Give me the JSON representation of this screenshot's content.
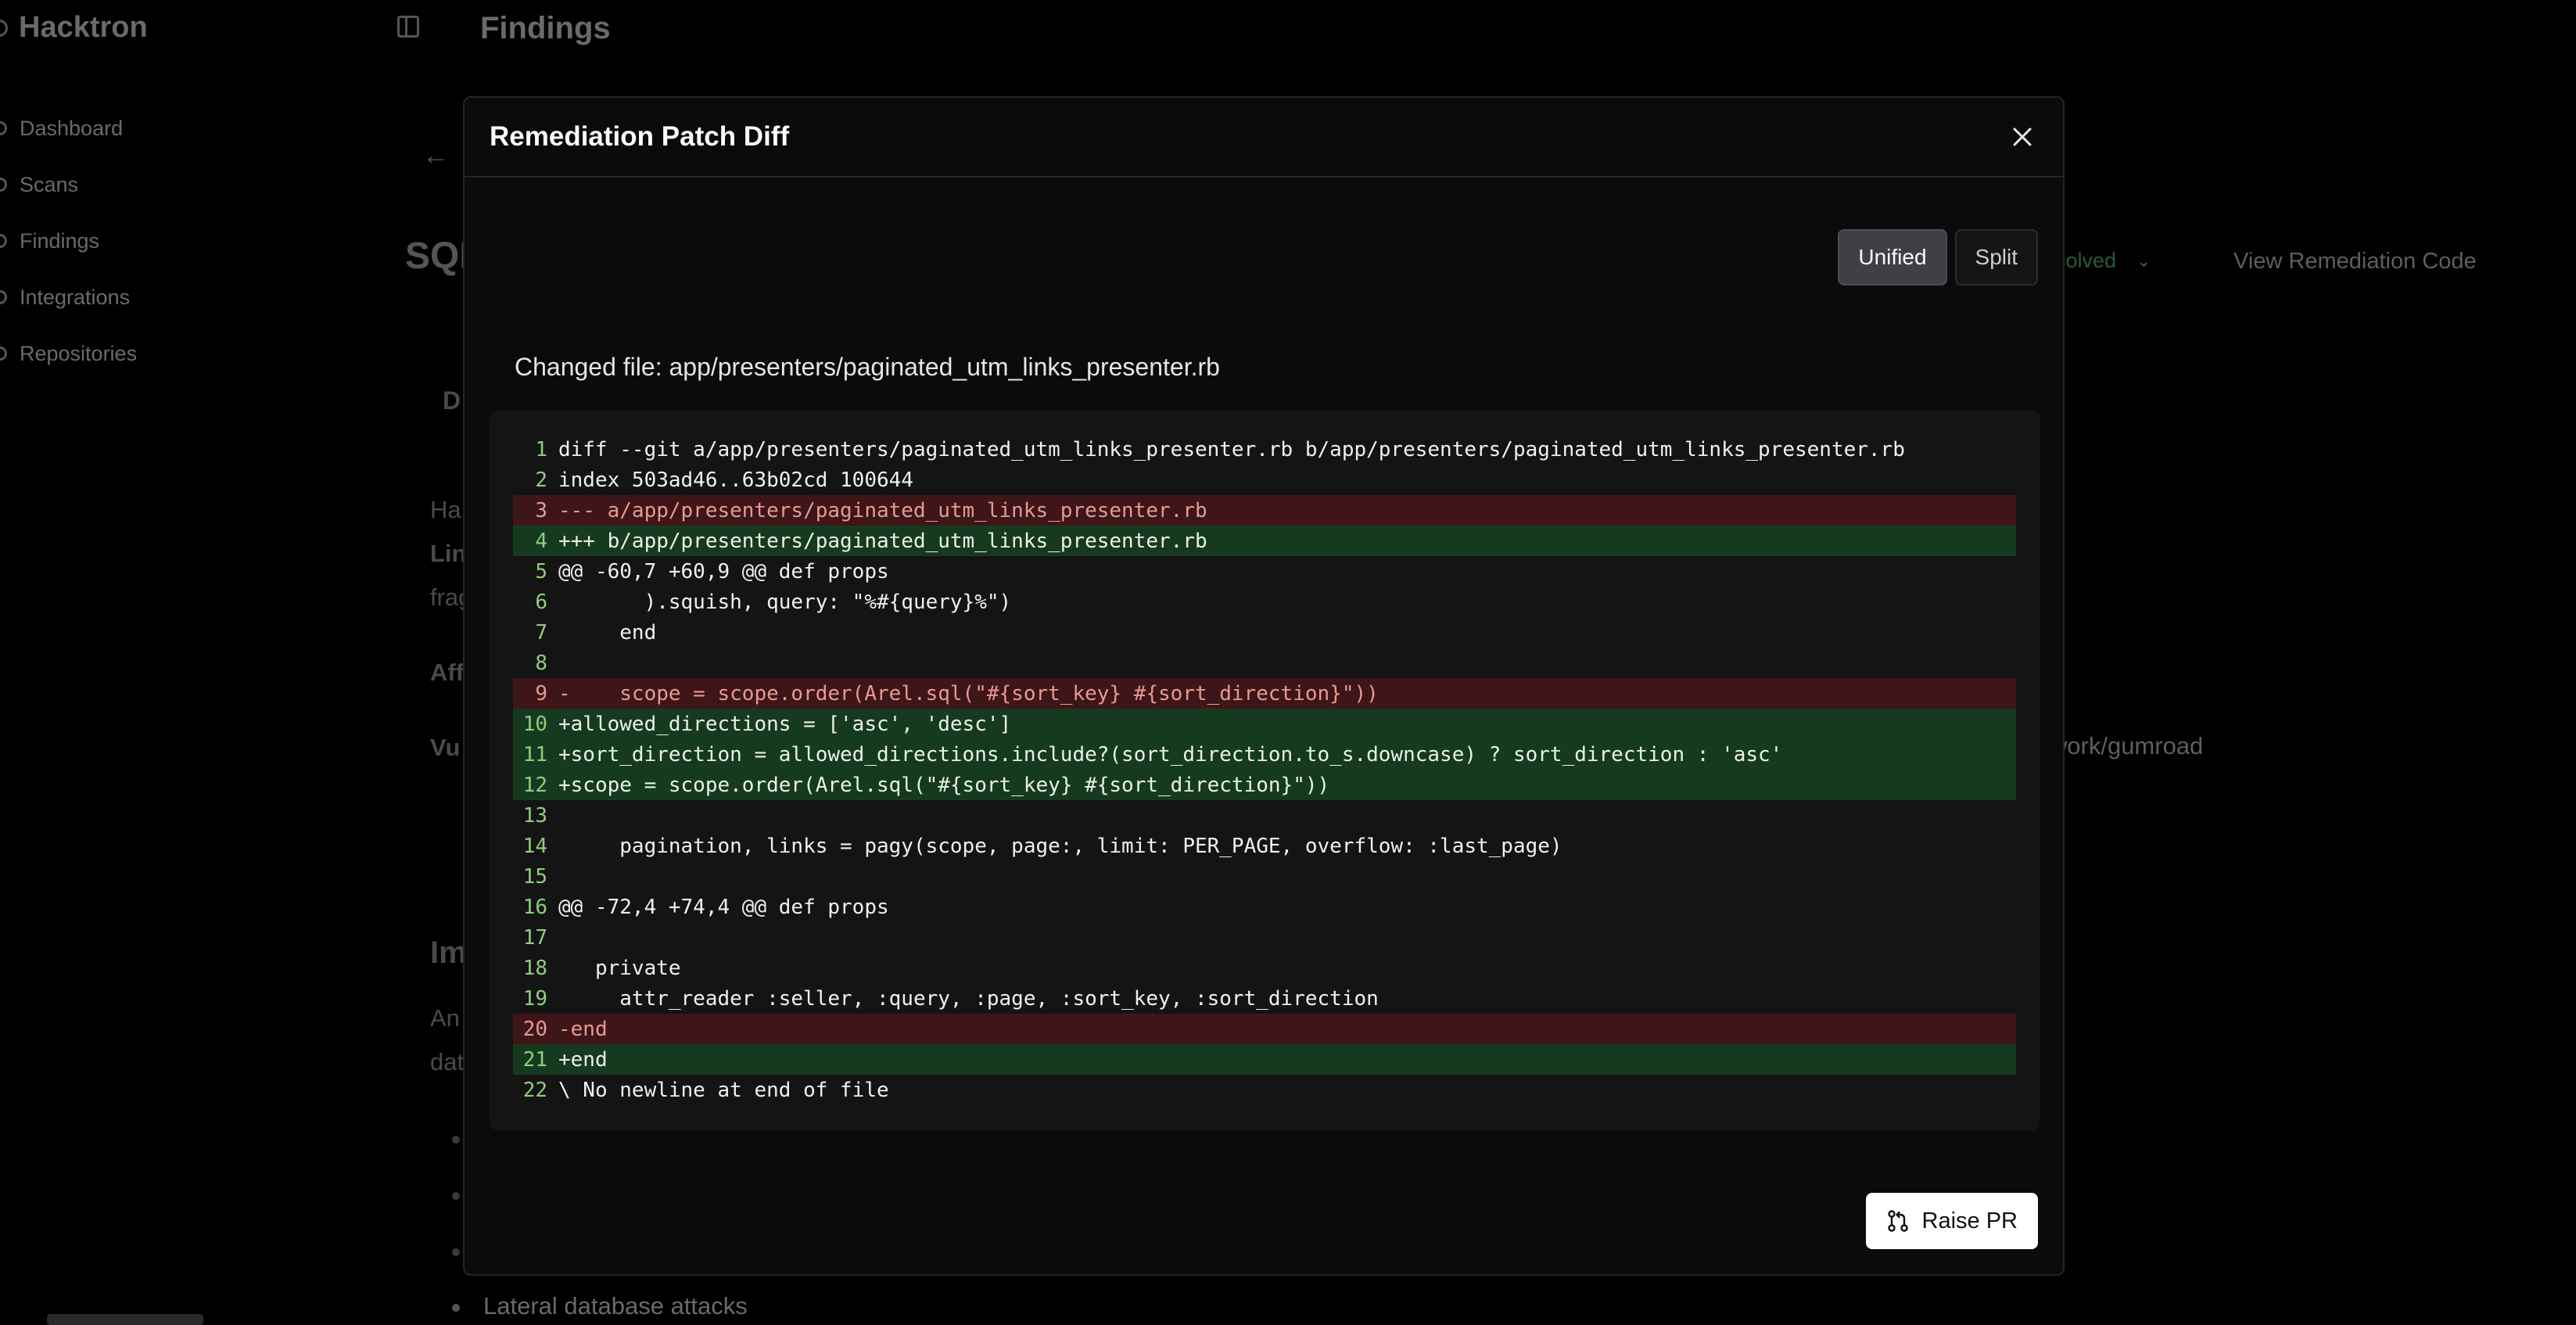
{
  "app": {
    "brand": "Hacktron",
    "page_title": "Findings",
    "nav": [
      {
        "label": "Dashboard",
        "icon": "home-icon"
      },
      {
        "label": "Scans",
        "icon": "search-icon"
      },
      {
        "label": "Findings",
        "icon": "alert-icon"
      },
      {
        "label": "Integrations",
        "icon": "plug-icon"
      },
      {
        "label": "Repositories",
        "icon": "git-branch-icon"
      }
    ],
    "background": {
      "finding_title_fragment": "SQL",
      "status_fragment": "solved",
      "view_remediation": "View Remediation Code",
      "repo_fragment": "iwork/gumroad",
      "frag_d": "D",
      "frag_ha": "Ha",
      "frag_lin": "Lin",
      "frag_frag": "frag",
      "frag_aff": "Aff",
      "frag_vu": "Vu",
      "frag_im": "Im",
      "frag_an": "An",
      "frag_dat": "dat",
      "last_bullet": "Lateral database attacks"
    }
  },
  "modal": {
    "title": "Remediation Patch Diff",
    "toggle": {
      "unified": "Unified",
      "split": "Split",
      "active": "unified"
    },
    "changed_file_label": "Changed file: app/presenters/paginated_utm_links_presenter.rb",
    "raise_pr": "Raise PR",
    "diff_lines": [
      {
        "n": "1",
        "type": "ctx",
        "text": "diff --git a/app/presenters/paginated_utm_links_presenter.rb b/app/presenters/paginated_utm_links_presenter.rb"
      },
      {
        "n": "2",
        "type": "ctx",
        "text": "index 503ad46..63b02cd 100644"
      },
      {
        "n": "3",
        "type": "del",
        "text": "--- a/app/presenters/paginated_utm_links_presenter.rb"
      },
      {
        "n": "4",
        "type": "add",
        "text": "+++ b/app/presenters/paginated_utm_links_presenter.rb"
      },
      {
        "n": "5",
        "type": "ctx",
        "text": "@@ -60,7 +60,9 @@ def props"
      },
      {
        "n": "6",
        "type": "ctx",
        "text": "       ).squish, query: \"%#{query}%\")"
      },
      {
        "n": "7",
        "type": "ctx",
        "text": "     end"
      },
      {
        "n": "8",
        "type": "ctx",
        "text": ""
      },
      {
        "n": "9",
        "type": "del",
        "text": "-    scope = scope.order(Arel.sql(\"#{sort_key} #{sort_direction}\"))"
      },
      {
        "n": "10",
        "type": "add",
        "text": "+allowed_directions = ['asc', 'desc']"
      },
      {
        "n": "11",
        "type": "add",
        "text": "+sort_direction = allowed_directions.include?(sort_direction.to_s.downcase) ? sort_direction : 'asc'"
      },
      {
        "n": "12",
        "type": "add",
        "text": "+scope = scope.order(Arel.sql(\"#{sort_key} #{sort_direction}\"))"
      },
      {
        "n": "13",
        "type": "ctx",
        "text": ""
      },
      {
        "n": "14",
        "type": "ctx",
        "text": "     pagination, links = pagy(scope, page:, limit: PER_PAGE, overflow: :last_page)"
      },
      {
        "n": "15",
        "type": "ctx",
        "text": ""
      },
      {
        "n": "16",
        "type": "ctx",
        "text": "@@ -72,4 +74,4 @@ def props"
      },
      {
        "n": "17",
        "type": "ctx",
        "text": ""
      },
      {
        "n": "18",
        "type": "ctx",
        "text": "   private"
      },
      {
        "n": "19",
        "type": "ctx",
        "text": "     attr_reader :seller, :query, :page, :sort_key, :sort_direction"
      },
      {
        "n": "20",
        "type": "del",
        "text": "-end"
      },
      {
        "n": "21",
        "type": "add",
        "text": "+end"
      },
      {
        "n": "22",
        "type": "ctx",
        "text": "\\ No newline at end of file"
      }
    ]
  }
}
